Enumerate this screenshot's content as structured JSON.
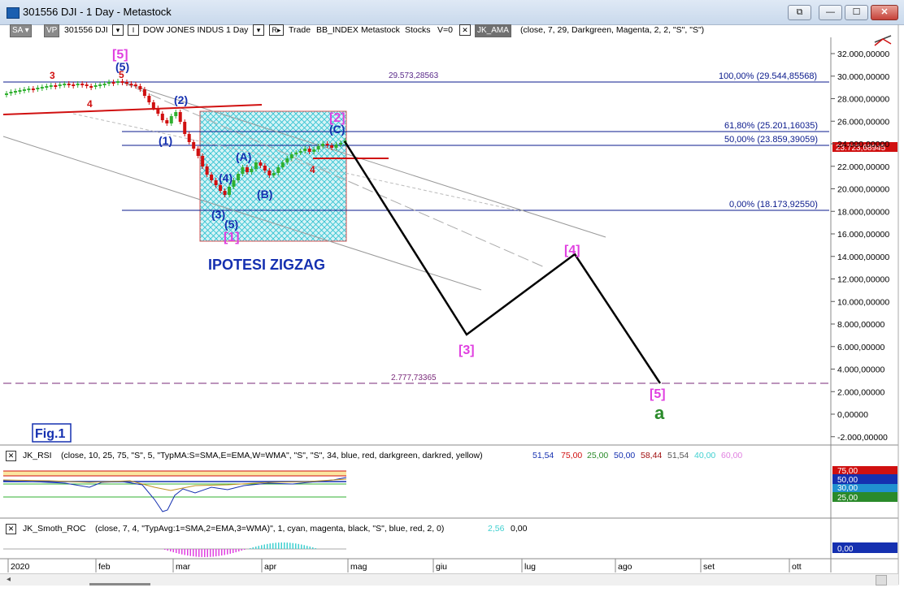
{
  "window": {
    "title": "301556 DJI - 1 Day - Metastock"
  },
  "toolbar": {
    "sa": "SA",
    "vp": "VP",
    "symbol": "301556 DJI",
    "security_name": "DOW JONES INDUS",
    "period": "1 Day",
    "r_btn": "R",
    "trade": "Trade",
    "index": "BB_INDEX",
    "source": "Metastock",
    "category": "Stocks",
    "v": "V=0",
    "ama": "JK_AMA",
    "ama_params": "(close,  7,  29,  Darkgreen,  Magenta,  2,  2,  \"S\",  \"S\")"
  },
  "price_axis": {
    "labels": [
      "32.000,00000",
      "30.000,00000",
      "28.000,00000",
      "26.000,00000",
      "24.000,00000",
      "22.000,00000",
      "20.000,00000",
      "18.000,00000",
      "16.000,00000",
      "14.000,00000",
      "12.000,00000",
      "10.000,00000",
      "8.000,00000",
      "6.000,00000",
      "4.000,00000",
      "2.000,00000",
      "0,00000",
      "-2.000,00000"
    ],
    "current_price": "23.723,68945"
  },
  "levels": {
    "top_value": "29.573,28563",
    "fib100": "100,00% (29.544,85568)",
    "fib618": "61,80% (25.201,16035)",
    "fib50": "50,00% (23.859,39059)",
    "fib0": "0,00% (18.173,92550)",
    "low_value": "2.777,73365"
  },
  "labels": {
    "w5top": "[5]",
    "w5blue_top": "(5)",
    "w5red_top": "5",
    "w3red": "3",
    "w4red": "4",
    "w1blue": "(1)",
    "w2blue": "(2)",
    "w3blue": "(3)",
    "w4blue": "(4)",
    "w5blue": "(5)",
    "wA": "(A)",
    "wB": "(B)",
    "wC": "(C)",
    "w4red2": "4",
    "w1mag": "[1]",
    "w2mag": "[2]",
    "w3mag": "[3]",
    "w4mag": "[4]",
    "w5mag": "[5]",
    "wa": "a",
    "zigzag": "IPOTESI ZIGZAG",
    "fig": "Fig.1"
  },
  "rsi": {
    "name": "JK_RSI",
    "params": "(close,  10,  25,  75,  \"S\",  5,  \"TypMA:S=SMA,E=EMA,W=WMA\",  \"S\",  \"S\",  34,  blue,  red,  darkgreen,  darkred,  yellow)",
    "v1": "51,54",
    "v2": "75,00",
    "v3": "25,00",
    "v4": "50,00",
    "v5": "58,44",
    "v6": "51,54",
    "v7": "40,00",
    "v8": "60,00",
    "axis": [
      "75,00",
      "50,00",
      "30,00",
      "25,00"
    ]
  },
  "roc": {
    "name": "JK_Smoth_ROC",
    "params": "(close,  7,  4,  \"TypAvg:1=SMA,2=EMA,3=WMA)\",  1,  cyan,  magenta,  black,  \"S\",  blue,  red,  2,  0)",
    "v1": "2,56",
    "v2": "0,00",
    "axis": "0,00"
  },
  "dates": [
    "2020",
    "feb",
    "mar",
    "apr",
    "mag",
    "giu",
    "lug",
    "ago",
    "set",
    "ott"
  ],
  "colors": {
    "price_line": "#0a1a8c",
    "magenta": "#e040e0",
    "red": "#d01010",
    "wave_blue": "#1530b0",
    "cyan": "#00c0d0",
    "green": "#2a8a2a"
  }
}
